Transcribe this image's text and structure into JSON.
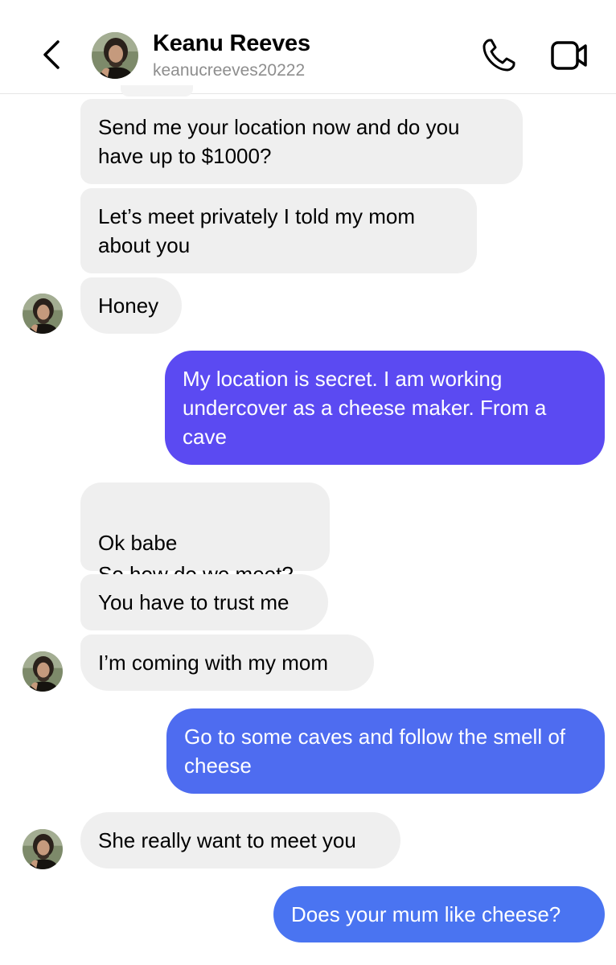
{
  "header": {
    "contact_name": "Keanu Reeves",
    "contact_handle": "keanucreeves20222"
  },
  "colors": {
    "incoming_bubble": "#efefef",
    "outgoing_purple": "#5b4af2",
    "outgoing_blue": "#4e6cf0",
    "outgoing_blue_2": "#4a74f1"
  },
  "icons": [
    "chevron-left-icon",
    "phone-icon",
    "video-camera-icon"
  ],
  "messages": [
    {
      "direction": "incoming",
      "text": "Send me your location now and do you have up to $1000?"
    },
    {
      "direction": "incoming",
      "text": "Let’s meet privately I told my mom about you"
    },
    {
      "direction": "incoming",
      "text": "Honey"
    },
    {
      "direction": "outgoing",
      "text": "My location is secret. I am working undercover as a cheese maker. From a cave"
    },
    {
      "direction": "incoming",
      "text": "Ok babe\nSo how do we meet?"
    },
    {
      "direction": "incoming",
      "text": "You have to trust me"
    },
    {
      "direction": "incoming",
      "text": "I’m coming with my mom"
    },
    {
      "direction": "outgoing",
      "text": "Go to some caves and follow the smell of cheese"
    },
    {
      "direction": "incoming",
      "text": "She really want to meet you"
    },
    {
      "direction": "outgoing",
      "text": "Does your mum like cheese?"
    }
  ]
}
